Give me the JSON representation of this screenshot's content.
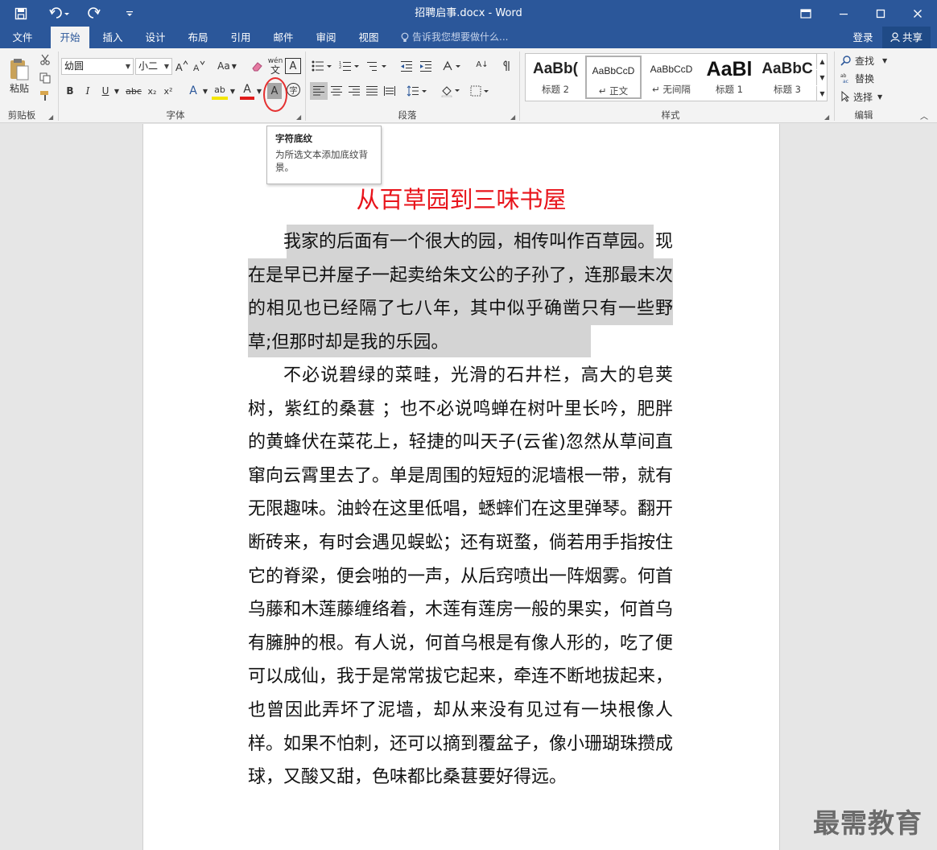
{
  "window": {
    "title": "招聘启事.docx - Word",
    "icons": [
      "save-icon",
      "undo-icon",
      "redo-icon",
      "customize-icon",
      "ribbon-display-icon",
      "minimize-icon",
      "maximize-icon",
      "close-icon"
    ]
  },
  "tabs": [
    {
      "label": "文件"
    },
    {
      "label": "开始",
      "active": true
    },
    {
      "label": "插入"
    },
    {
      "label": "设计"
    },
    {
      "label": "布局"
    },
    {
      "label": "引用"
    },
    {
      "label": "邮件"
    },
    {
      "label": "审阅"
    },
    {
      "label": "视图"
    }
  ],
  "tellme": "告诉我您想要做什么...",
  "account": {
    "login": "登录",
    "share": "共享"
  },
  "ribbon": {
    "clipboard": {
      "paste": "粘贴",
      "label": "剪贴板"
    },
    "font": {
      "name": "幼圆",
      "size": "小二",
      "label": "字体",
      "aa_label": "Aa",
      "wen_label": "wén",
      "wen_char": "文",
      "boxed_a": "A",
      "bold": "B",
      "italic": "I",
      "underline": "U",
      "strike": "abc",
      "sub": "x₂",
      "sup": "x²",
      "effects": "A",
      "highlight": "ab",
      "color": "A",
      "shading": "A",
      "enclose": "字"
    },
    "paragraph": {
      "label": "段落",
      "sort": "A↓"
    },
    "styles": {
      "label": "样式",
      "items": [
        {
          "preview": "AaBb(",
          "name": "标题 2"
        },
        {
          "preview": "AaBbCcD",
          "name": "↵ 正文"
        },
        {
          "preview": "AaBbCcD",
          "name": "↵ 无间隔"
        },
        {
          "preview": "AaBl",
          "name": "标题 1"
        },
        {
          "preview": "AaBbC",
          "name": "标题 3"
        }
      ]
    },
    "editing": {
      "find": "查找",
      "replace": "替换",
      "select": "选择",
      "label": "编辑"
    }
  },
  "tooltip": {
    "title": "字符底纹",
    "desc": "为所选文本添加底纹背景。"
  },
  "document": {
    "heading": "从百草园到三味书屋",
    "para1": "我家的后面有一个很大的园，相传叫作百草园。现在是早已并屋子一起卖给朱文公的子孙了，连那最末次的相见也已经隔了七八年，其中似乎确凿只有一些野草;但那时却是我的乐园。",
    "para2": "不必说碧绿的菜畦，光滑的石井栏，高大的皂荚树，紫红的桑葚 ；也不必说鸣蝉在树叶里长吟，肥胖的黄蜂伏在菜花上，轻捷的叫天子(云雀)忽然从草间直窜向云霄里去了。单是周围的短短的泥墙根一带，就有无限趣味。油蛉在这里低唱，蟋蟀们在这里弹琴。翻开断砖来，有时会遇见蜈蚣；还有斑蝥，倘若用手指按住它的脊梁，便会啪的一声，从后窍喷出一阵烟雾。何首乌藤和木莲藤缠络着，木莲有莲房一般的果实，何首乌有臃肿的根。有人说，何首乌根是有像人形的，吃了便可以成仙，我于是常常拔它起来，牵连不断地拔起来，也曾因此弄坏了泥墙，却从来没有见过有一块根像人样。如果不怕刺，还可以摘到覆盆子，像小珊瑚珠攒成球，又酸又甜，色味都比桑葚要好得远。"
  },
  "watermark": "最需教育",
  "colors": {
    "brand": "#2b579a",
    "heading": "#e8141b",
    "shading": "#d4d4d4",
    "annotation": "#e53030"
  }
}
